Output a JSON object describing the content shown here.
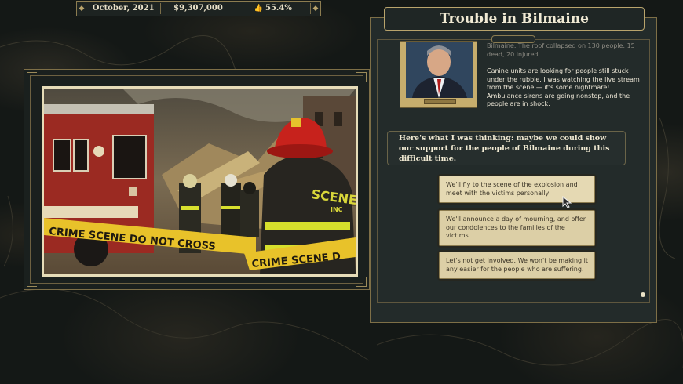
{
  "topbar": {
    "date": "October, 2021",
    "money": "$9,307,000",
    "approval": "55.4%",
    "approval_icon": "thumbs-up-icon"
  },
  "event": {
    "title": "Trouble in Bilmaine",
    "story_fragment": "Bilmaine. The roof collapsed on 130 people. 15 dead, 20 injured.",
    "story_body": "Canine units are looking for people still stuck under the rubble. I was watching the live stream from the scene — it's some nightmare! Ambulance sirens are going nonstop, and the people are in shock.",
    "advisor_speech": "Here's what I was thinking: maybe we could show our support for the people of Bilmaine during this difficult time."
  },
  "scene": {
    "tape_text_1": "CRIME SCENE DO NOT CROSS",
    "tape_text_2": "CRIME SCENE D",
    "jacket_text_1": "SCENE",
    "jacket_text_2": "INC"
  },
  "choices": [
    {
      "label": "We'll fly to the scene of the explosion and meet with the victims personally"
    },
    {
      "label": "We'll announce a day of mourning, and offer our condolences to the families of the victims."
    },
    {
      "label": "Let's not get involved. We won't be making it any easier for the people who are suffering."
    }
  ],
  "colors": {
    "gold": "#b9a46c",
    "panel": "#232b2a",
    "choice_bg": "#dccfa6",
    "tape": "#e8c22a"
  }
}
